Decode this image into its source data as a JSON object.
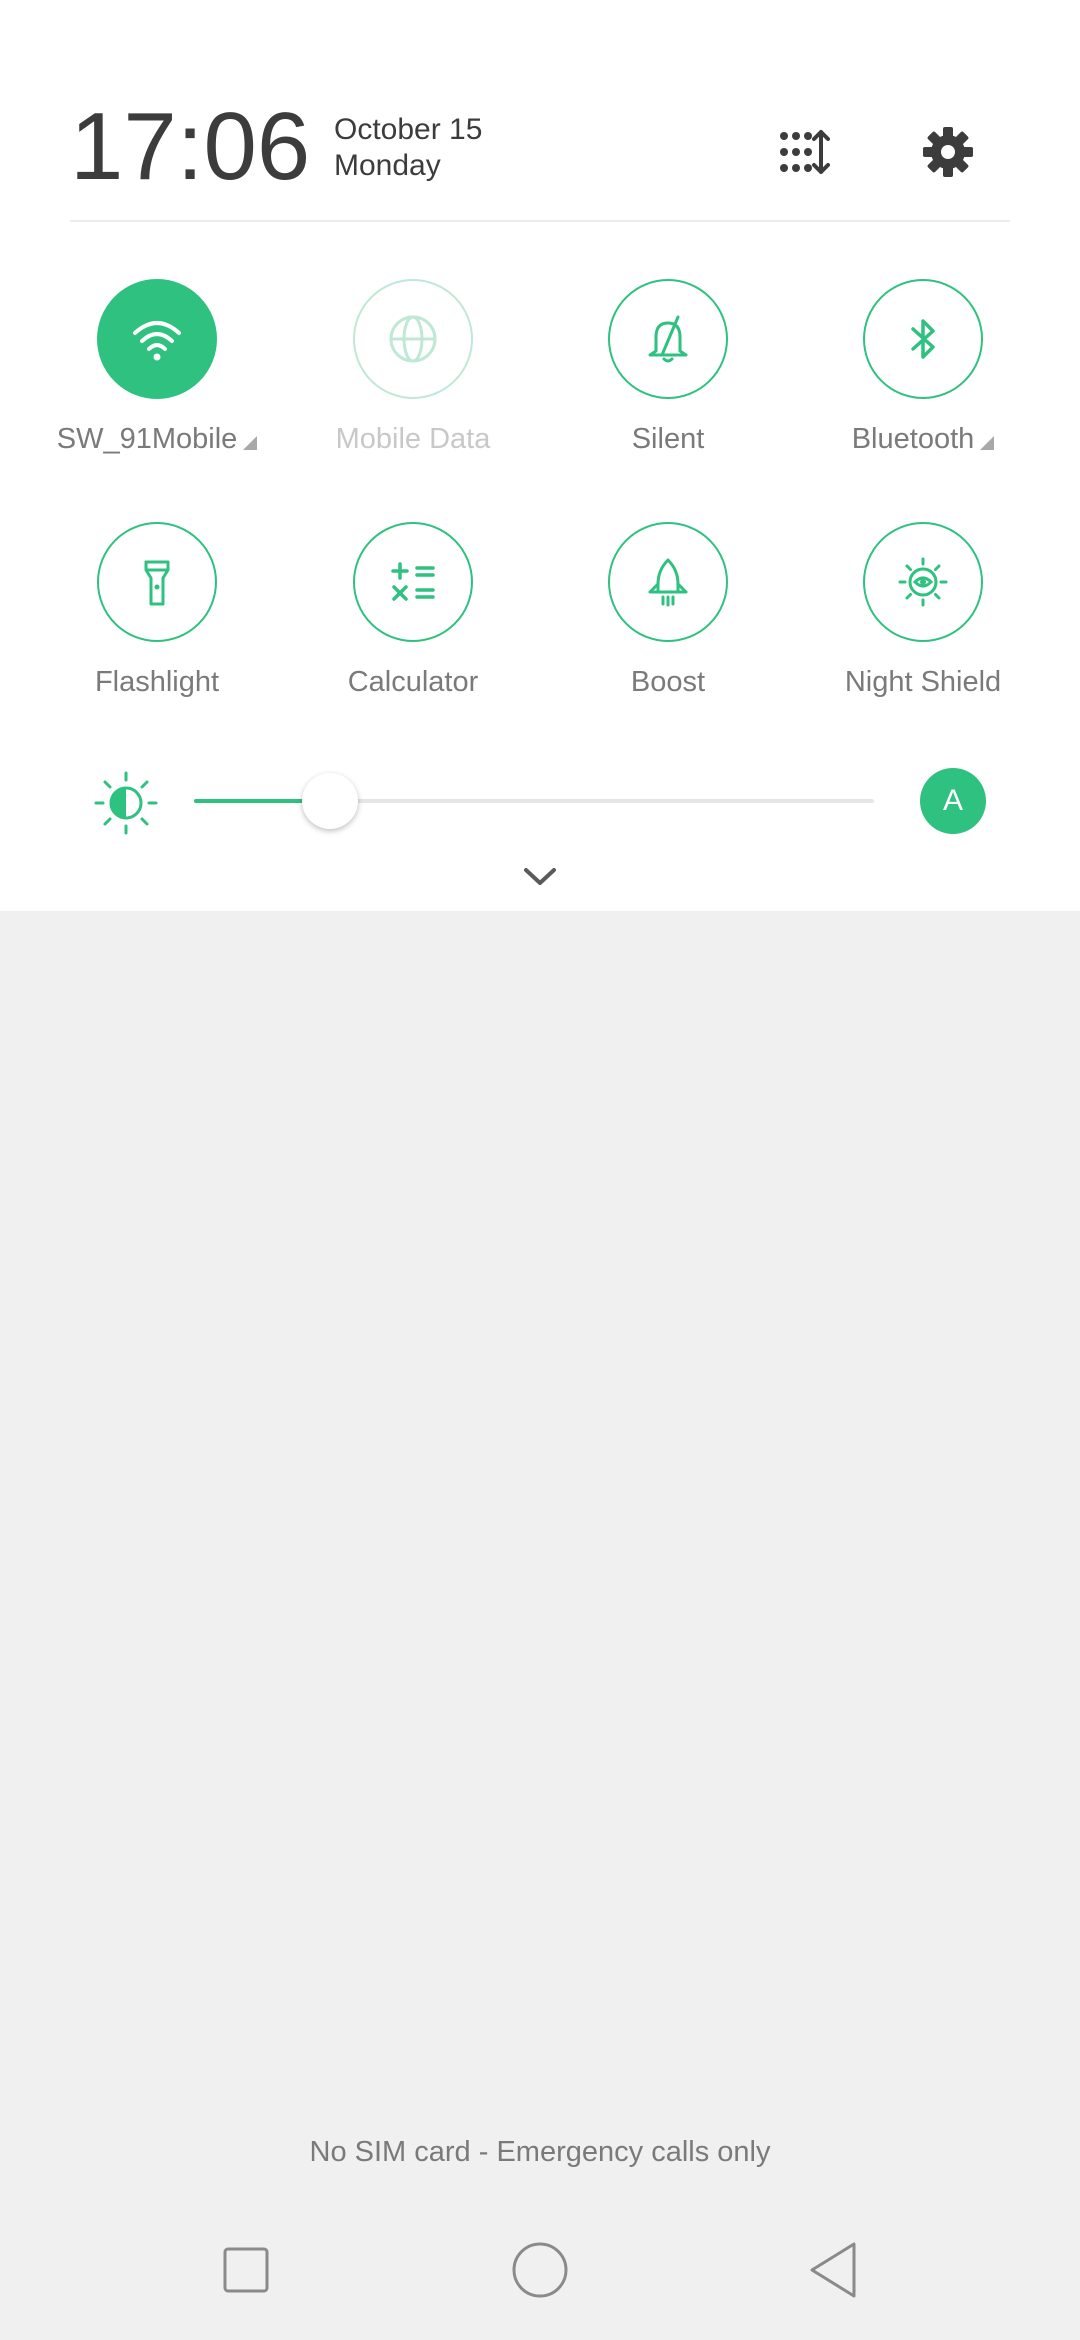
{
  "header": {
    "time": "17:06",
    "date": "October 15",
    "weekday": "Monday",
    "edit_icon": "grid-reorder-icon",
    "settings_icon": "gear-icon"
  },
  "tiles": [
    {
      "label": "SW_91Mobile",
      "icon": "wifi-icon",
      "state": "active",
      "has_menu": true
    },
    {
      "label": "Mobile Data",
      "icon": "globe-icon",
      "state": "disabled",
      "has_menu": false
    },
    {
      "label": "Silent",
      "icon": "bell-off-icon",
      "state": "off",
      "has_menu": false
    },
    {
      "label": "Bluetooth",
      "icon": "bluetooth-icon",
      "state": "off",
      "has_menu": true
    },
    {
      "label": "Flashlight",
      "icon": "flashlight-icon",
      "state": "off",
      "has_menu": false
    },
    {
      "label": "Calculator",
      "icon": "calculator-icon",
      "state": "off",
      "has_menu": false
    },
    {
      "label": "Boost",
      "icon": "rocket-icon",
      "state": "off",
      "has_menu": false
    },
    {
      "label": "Night Shield",
      "icon": "eye-sun-icon",
      "state": "off",
      "has_menu": false
    }
  ],
  "brightness": {
    "level": 0.2,
    "auto_label": "A"
  },
  "status": {
    "sim_text": "No SIM card - Emergency calls only"
  },
  "nav": {
    "recents_icon": "square-icon",
    "home_icon": "circle-icon",
    "back_icon": "triangle-back-icon"
  },
  "colors": {
    "accent": "#2fc17f",
    "text": "#3c3c3c",
    "secondary_text": "#7a7a7a",
    "panel": "#ffffff",
    "background": "#f0f0f0"
  }
}
